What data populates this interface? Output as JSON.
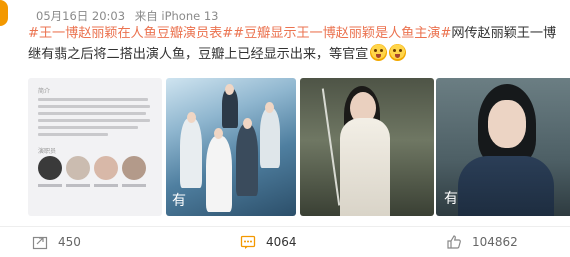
{
  "post": {
    "date": "05月16日 20:03",
    "source": "来自 iPhone 13",
    "tag1": "#王一博赵丽颖在人鱼豆瓣演员表#",
    "tag2": "#豆瓣显示王一博赵丽颖是人鱼主演#",
    "body": "网传赵丽颖王一博继有翡之后将二搭出演人鱼，豆瓣上已经显示出来，等官宣",
    "emojis": [
      "scream-emoji",
      "scream-emoji"
    ]
  },
  "photos": [
    {
      "name": "douban-cast-screenshot",
      "label": "简介",
      "section": "演职员"
    },
    {
      "name": "drama-poster-group",
      "brand": "有"
    },
    {
      "name": "actress-with-sword"
    },
    {
      "name": "actor-portrait",
      "brand": "有"
    }
  ],
  "actions": {
    "repost_count": "450",
    "comment_count": "4064",
    "like_count": "104862"
  },
  "colors": {
    "tag": "#eb7350",
    "meta": "#8a8a8a",
    "accent": "#f39800"
  }
}
